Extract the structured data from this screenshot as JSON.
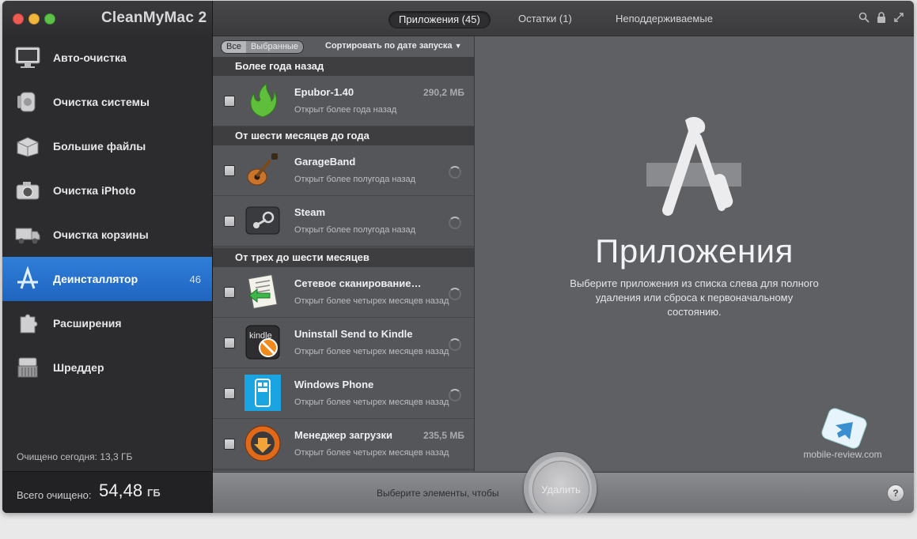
{
  "app": {
    "title": "CleanMyMac 2"
  },
  "sidebar": {
    "items": [
      {
        "label": "Авто-очистка",
        "icon": "monitor-icon"
      },
      {
        "label": "Очистка системы",
        "icon": "vacuum-icon"
      },
      {
        "label": "Большие файлы",
        "icon": "box-icon"
      },
      {
        "label": "Очистка iPhoto",
        "icon": "camera-icon"
      },
      {
        "label": "Очистка корзины",
        "icon": "truck-icon"
      },
      {
        "label": "Деинсталлятор",
        "icon": "app-store-icon",
        "count": "46",
        "active": true
      },
      {
        "label": "Расширения",
        "icon": "puzzle-icon"
      },
      {
        "label": "Шреддер",
        "icon": "shredder-icon"
      }
    ],
    "today": "Очищено сегодня: 13,3 ГБ",
    "total_label": "Всего очищено:",
    "total_value": "54,48",
    "total_unit": "ГБ"
  },
  "topbar": {
    "tabs": [
      {
        "label": "Приложения (45)",
        "active": true
      },
      {
        "label": "Остатки (1)",
        "active": false
      },
      {
        "label": "Неподдерживаемые",
        "active": false
      }
    ],
    "icons": [
      "search-icon",
      "lock-icon",
      "fullscreen-icon"
    ]
  },
  "list": {
    "filter_all": "Все",
    "filter_selected": "Выбранные",
    "sort_label": "Сортировать по дате запуска",
    "sections": [
      {
        "title": "Более года назад"
      },
      {
        "title": "От шести месяцев до года"
      },
      {
        "title": "От трех до шести месяцев"
      }
    ],
    "apps": [
      {
        "name": "Epubor-1.40",
        "subtitle": "Открыт более года назад",
        "size": "290,2 МБ"
      },
      {
        "name": "GarageBand",
        "subtitle": "Открыт более полугода назад",
        "size": ""
      },
      {
        "name": "Steam",
        "subtitle": "Открыт более полугода назад",
        "size": ""
      },
      {
        "name": "Сетевое сканирование…",
        "subtitle": "Открыт более четырех месяцев назад",
        "size": ""
      },
      {
        "name": "Uninstall Send to Kindle",
        "subtitle": "Открыт более четырех месяцев назад",
        "size": ""
      },
      {
        "name": "Windows Phone",
        "subtitle": "Открыт более четырех месяцев назад",
        "size": ""
      },
      {
        "name": "Менеджер загрузки",
        "subtitle": "Открыт более четырех месяцев назад",
        "size": "235,5 МБ"
      }
    ]
  },
  "detail": {
    "title": "Приложения",
    "description": "Выберите приложения из списка слева для полного удаления или сброса к первоначальному состоянию.",
    "watermark": "mobile-review.com"
  },
  "bottombar": {
    "hint": "Выберите элементы, чтобы",
    "delete_label": "Удалить",
    "help_label": "?"
  }
}
